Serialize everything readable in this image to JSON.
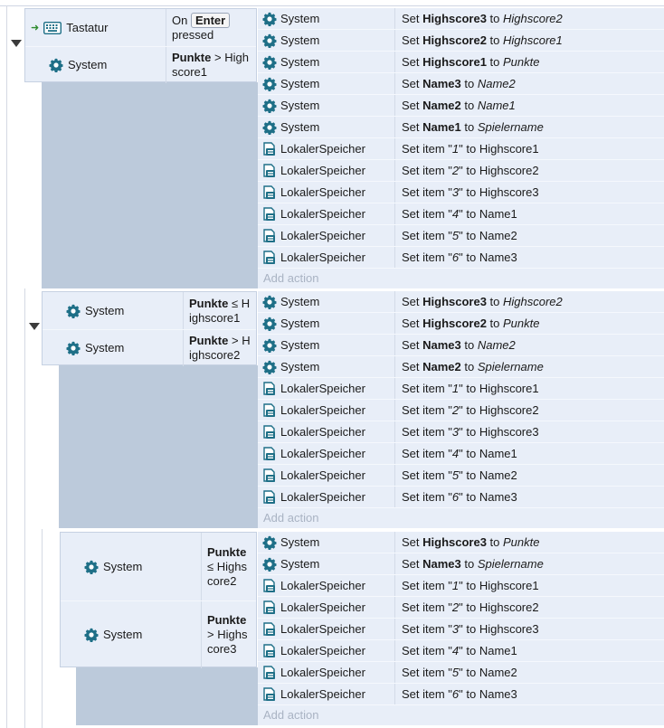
{
  "events": [
    {
      "conditions": [
        {
          "object": "Tastatur",
          "icon": "keyboard-icon",
          "type": "kbd",
          "parts": [
            "On",
            "Enter",
            "pressed"
          ]
        },
        {
          "object": "System",
          "icon": "gear-icon",
          "type": "cmp",
          "parts": [
            "Punkte",
            ">",
            "Highscore1"
          ]
        }
      ],
      "actions": [
        {
          "object": "System",
          "icon": "gear-icon",
          "pre": "Set ",
          "target": "Highscore3",
          "mid": " to ",
          "value": "Highscore2",
          "value_style": "italic"
        },
        {
          "object": "System",
          "icon": "gear-icon",
          "pre": "Set ",
          "target": "Highscore2",
          "mid": " to ",
          "value": "Highscore1",
          "value_style": "italic"
        },
        {
          "object": "System",
          "icon": "gear-icon",
          "pre": "Set ",
          "target": "Highscore1",
          "mid": " to ",
          "value": "Punkte",
          "value_style": "italic"
        },
        {
          "object": "System",
          "icon": "gear-icon",
          "pre": "Set ",
          "target": "Name3",
          "mid": " to ",
          "value": "Name2",
          "value_style": "italic"
        },
        {
          "object": "System",
          "icon": "gear-icon",
          "pre": "Set ",
          "target": "Name2",
          "mid": " to ",
          "value": "Name1",
          "value_style": "italic"
        },
        {
          "object": "System",
          "icon": "gear-icon",
          "pre": "Set ",
          "target": "Name1",
          "mid": " to ",
          "value": "Spielername",
          "value_style": "italic"
        },
        {
          "object": "LokalerSpeicher",
          "icon": "local-storage-icon",
          "pre": "Set item \"",
          "target": "1",
          "mid": "\" to ",
          "value": "Highscore1",
          "value_style": "plain"
        },
        {
          "object": "LokalerSpeicher",
          "icon": "local-storage-icon",
          "pre": "Set item \"",
          "target": "2",
          "mid": "\" to ",
          "value": "Highscore2",
          "value_style": "plain"
        },
        {
          "object": "LokalerSpeicher",
          "icon": "local-storage-icon",
          "pre": "Set item \"",
          "target": "3",
          "mid": "\" to ",
          "value": "Highscore3",
          "value_style": "plain"
        },
        {
          "object": "LokalerSpeicher",
          "icon": "local-storage-icon",
          "pre": "Set item \"",
          "target": "4",
          "mid": "\" to ",
          "value": "Name1",
          "value_style": "plain"
        },
        {
          "object": "LokalerSpeicher",
          "icon": "local-storage-icon",
          "pre": "Set item \"",
          "target": "5",
          "mid": "\" to ",
          "value": "Name2",
          "value_style": "plain"
        },
        {
          "object": "LokalerSpeicher",
          "icon": "local-storage-icon",
          "pre": "Set item \"",
          "target": "6",
          "mid": "\" to ",
          "value": "Name3",
          "value_style": "plain"
        }
      ],
      "add_action": "Add action"
    },
    {
      "conditions": [
        {
          "object": "System",
          "icon": "gear-icon",
          "type": "cmp",
          "parts": [
            "Punkte",
            "≤",
            "Highscore1"
          ]
        },
        {
          "object": "System",
          "icon": "gear-icon",
          "type": "cmp",
          "parts": [
            "Punkte",
            ">",
            "Highscore2"
          ]
        }
      ],
      "actions": [
        {
          "object": "System",
          "icon": "gear-icon",
          "pre": "Set ",
          "target": "Highscore3",
          "mid": " to ",
          "value": "Highscore2",
          "value_style": "italic"
        },
        {
          "object": "System",
          "icon": "gear-icon",
          "pre": "Set ",
          "target": "Highscore2",
          "mid": " to ",
          "value": "Punkte",
          "value_style": "italic"
        },
        {
          "object": "System",
          "icon": "gear-icon",
          "pre": "Set ",
          "target": "Name3",
          "mid": " to ",
          "value": "Name2",
          "value_style": "italic"
        },
        {
          "object": "System",
          "icon": "gear-icon",
          "pre": "Set ",
          "target": "Name2",
          "mid": " to ",
          "value": "Spielername",
          "value_style": "italic"
        },
        {
          "object": "LokalerSpeicher",
          "icon": "local-storage-icon",
          "pre": "Set item \"",
          "target": "1",
          "mid": "\" to ",
          "value": "Highscore1",
          "value_style": "plain"
        },
        {
          "object": "LokalerSpeicher",
          "icon": "local-storage-icon",
          "pre": "Set item \"",
          "target": "2",
          "mid": "\" to ",
          "value": "Highscore2",
          "value_style": "plain"
        },
        {
          "object": "LokalerSpeicher",
          "icon": "local-storage-icon",
          "pre": "Set item \"",
          "target": "3",
          "mid": "\" to ",
          "value": "Highscore3",
          "value_style": "plain"
        },
        {
          "object": "LokalerSpeicher",
          "icon": "local-storage-icon",
          "pre": "Set item \"",
          "target": "4",
          "mid": "\" to ",
          "value": "Name1",
          "value_style": "plain"
        },
        {
          "object": "LokalerSpeicher",
          "icon": "local-storage-icon",
          "pre": "Set item \"",
          "target": "5",
          "mid": "\" to ",
          "value": "Name2",
          "value_style": "plain"
        },
        {
          "object": "LokalerSpeicher",
          "icon": "local-storage-icon",
          "pre": "Set item \"",
          "target": "6",
          "mid": "\" to ",
          "value": "Name3",
          "value_style": "plain"
        }
      ],
      "add_action": "Add action"
    },
    {
      "conditions": [
        {
          "object": "System",
          "icon": "gear-icon",
          "type": "cmp",
          "parts": [
            "Punkte",
            "≤",
            "Highscore2"
          ]
        },
        {
          "object": "System",
          "icon": "gear-icon",
          "type": "cmp",
          "parts": [
            "Punkte",
            ">",
            "Highscore3"
          ]
        }
      ],
      "actions": [
        {
          "object": "System",
          "icon": "gear-icon",
          "pre": "Set ",
          "target": "Highscore3",
          "mid": " to ",
          "value": "Punkte",
          "value_style": "italic"
        },
        {
          "object": "System",
          "icon": "gear-icon",
          "pre": "Set ",
          "target": "Name3",
          "mid": " to ",
          "value": "Spielername",
          "value_style": "italic"
        },
        {
          "object": "LokalerSpeicher",
          "icon": "local-storage-icon",
          "pre": "Set item \"",
          "target": "1",
          "mid": "\" to ",
          "value": "Highscore1",
          "value_style": "plain"
        },
        {
          "object": "LokalerSpeicher",
          "icon": "local-storage-icon",
          "pre": "Set item \"",
          "target": "2",
          "mid": "\" to ",
          "value": "Highscore2",
          "value_style": "plain"
        },
        {
          "object": "LokalerSpeicher",
          "icon": "local-storage-icon",
          "pre": "Set item \"",
          "target": "3",
          "mid": "\" to ",
          "value": "Highscore3",
          "value_style": "plain"
        },
        {
          "object": "LokalerSpeicher",
          "icon": "local-storage-icon",
          "pre": "Set item \"",
          "target": "4",
          "mid": "\" to ",
          "value": "Name1",
          "value_style": "plain"
        },
        {
          "object": "LokalerSpeicher",
          "icon": "local-storage-icon",
          "pre": "Set item \"",
          "target": "5",
          "mid": "\" to ",
          "value": "Name2",
          "value_style": "plain"
        },
        {
          "object": "LokalerSpeicher",
          "icon": "local-storage-icon",
          "pre": "Set item \"",
          "target": "6",
          "mid": "\" to ",
          "value": "Name3",
          "value_style": "plain"
        }
      ],
      "add_action": "Add action"
    }
  ],
  "colors": {
    "icon": "#1e6f87",
    "trigger_arrow": "#2e8b2e",
    "row_bg": "#e8eef8",
    "sub_bg": "#bccadb",
    "add_action_text": "#a9b3c3"
  }
}
